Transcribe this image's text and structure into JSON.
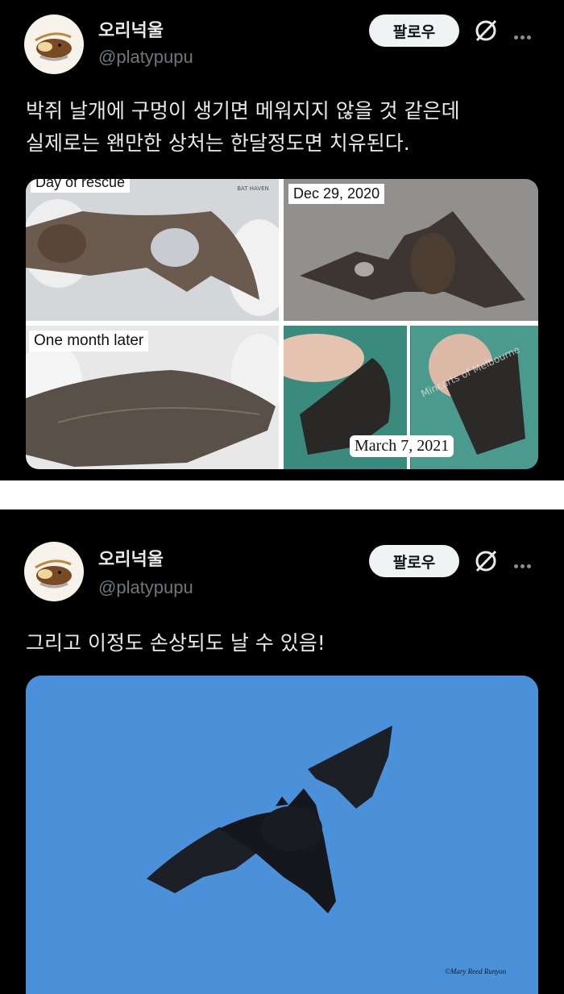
{
  "posts": [
    {
      "author_name": "오리넉울",
      "author_handle": "@platypupu",
      "follow_label": "팔로우",
      "text_line1": "박쥐 날개에 구멍이 생기면 메워지지 않을 것 같은데",
      "text_line2": "실제로는 왠만한 상처는 한달정도면 치유된다.",
      "media_captions": {
        "top_left": "Day of rescue",
        "top_right": "Dec 29, 2020",
        "bottom_left": "One month later",
        "bottom_right": "March 7, 2021"
      },
      "watermarks": {
        "top_left": "BAT HAVEN",
        "bottom_right": "Mincarts of Melbourne"
      }
    },
    {
      "author_name": "오리넉울",
      "author_handle": "@platypupu",
      "follow_label": "팔로우",
      "text_line1": "그리고 이정도 손상되도 날 수 있음!",
      "photo_credit": "©Mary Reed Runyon"
    }
  ],
  "icons": {
    "grok": "grok-icon",
    "more": "more-icon"
  },
  "colors": {
    "background": "#000000",
    "text": "#e7e9ea",
    "handle": "#71767b",
    "follow_button": "#eff3f4",
    "sky": "#4a90d9"
  }
}
